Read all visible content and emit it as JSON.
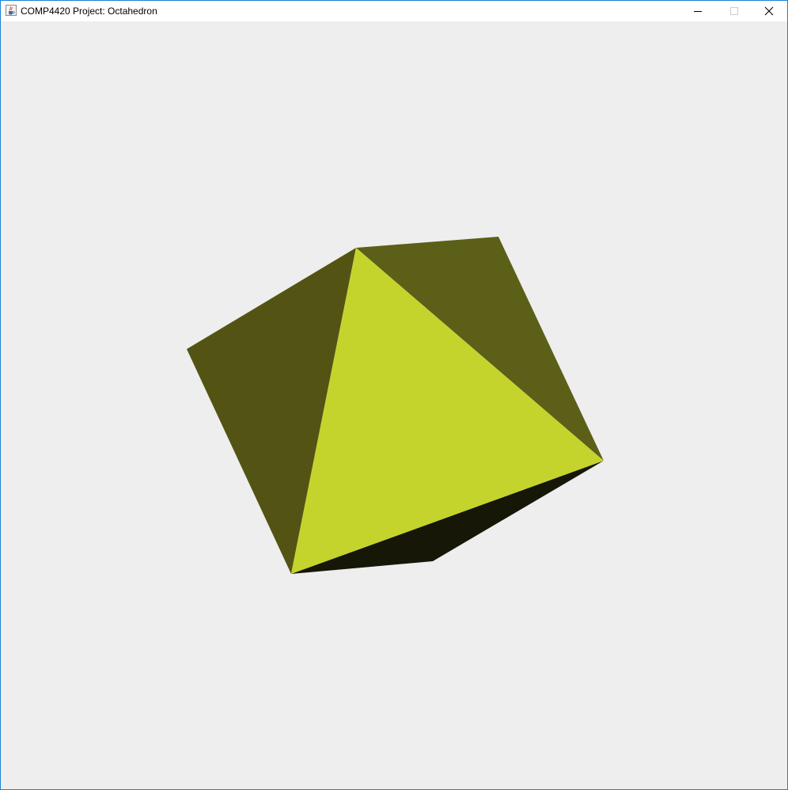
{
  "window": {
    "title": "COMP4420 Project: Octahedron",
    "app_icon": "java-cup-icon",
    "controls": {
      "minimize_icon": "minimize-icon",
      "maximize_icon": "maximize-icon",
      "close_icon": "close-icon"
    }
  },
  "scene": {
    "object": "octahedron",
    "background_color": "#eeeeee",
    "face_colors": {
      "front": "#c4d42d",
      "upper_left": "#535414",
      "upper_right": "#5c5f17",
      "bottom": "#161707"
    }
  }
}
